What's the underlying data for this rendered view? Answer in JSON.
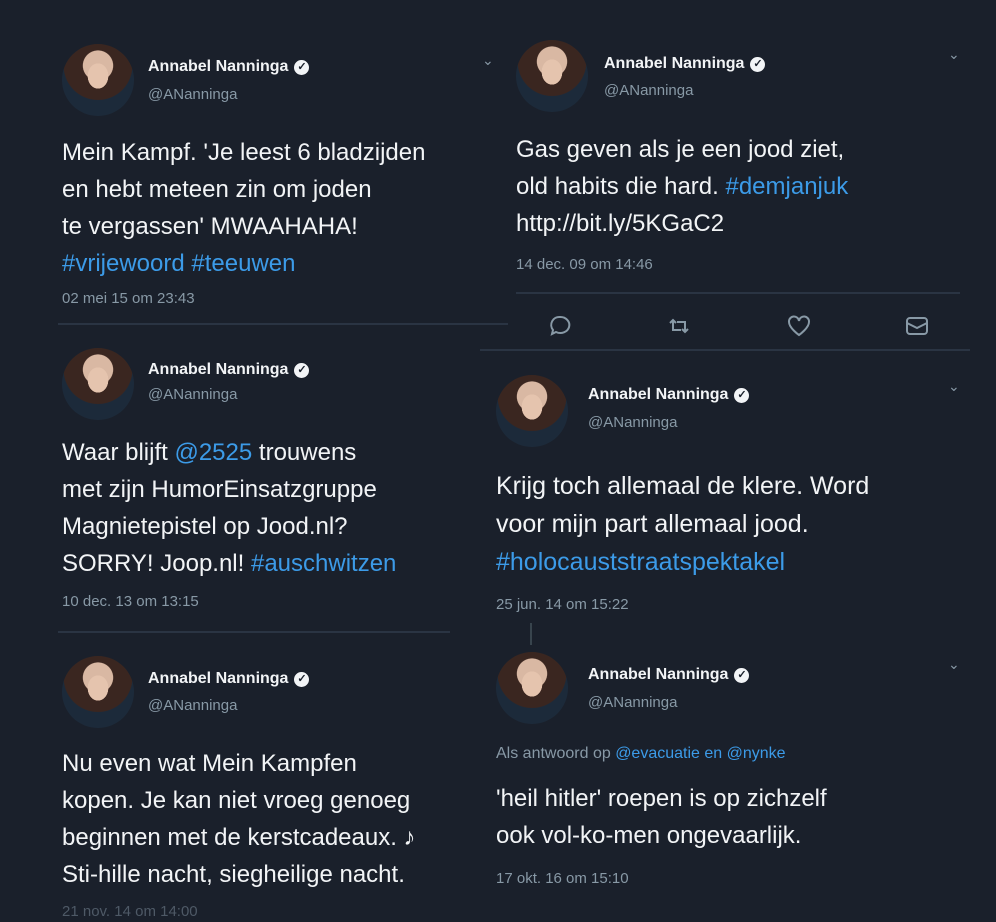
{
  "account": {
    "name": "Annabel Nanninga",
    "handle": "@ANanninga",
    "verified_glyph": "✓"
  },
  "chevron_glyph": "⌄",
  "colors": {
    "background": "#1a202b",
    "hashtag": "#3c9be8",
    "muted": "#8899a6"
  },
  "tweets": [
    {
      "lines": [
        [
          {
            "t": "Mein Kampf. 'Je leest 6 bladzijden"
          }
        ],
        [
          {
            "t": "en hebt meteen zin om joden"
          }
        ],
        [
          {
            "t": "te vergassen' MWAAHAHA!"
          }
        ],
        [
          {
            "t": "#vrijewoord",
            "tag": true
          },
          {
            "t": " "
          },
          {
            "t": "#teeuwen",
            "tag": true
          }
        ]
      ],
      "timestamp": "02 mei 15 om 23:43"
    },
    {
      "lines": [
        [
          {
            "t": "Gas geven als je een jood ziet,"
          }
        ],
        [
          {
            "t": "old habits die hard. "
          },
          {
            "t": "#demjanjuk",
            "tag": true
          }
        ],
        [
          {
            "t": "http://bit.ly/5KGaC2"
          }
        ]
      ],
      "timestamp": "14 dec. 09 om 14:46",
      "actions": [
        "reply-icon",
        "retweet-icon",
        "like-icon",
        "message-icon"
      ]
    },
    {
      "lines": [
        [
          {
            "t": "Waar blijft "
          },
          {
            "t": "@2525",
            "tag": true
          },
          {
            "t": " trouwens"
          }
        ],
        [
          {
            "t": "met zijn HumorEinsatzgruppe"
          }
        ],
        [
          {
            "t": "Magnietepistel op Jood.nl?"
          }
        ],
        [
          {
            "t": "SORRY! Joop.nl! "
          },
          {
            "t": "#auschwitzen",
            "tag": true
          }
        ]
      ],
      "timestamp": "10 dec. 13 om 13:15"
    },
    {
      "lines": [
        [
          {
            "t": "Krijg toch allemaal de klere. Word"
          }
        ],
        [
          {
            "t": "voor mijn part allemaal jood."
          }
        ],
        [
          {
            "t": "#holocauststraatspektakel",
            "tag": true
          }
        ]
      ],
      "timestamp": "25 jun. 14 om 15:22"
    },
    {
      "lines": [
        [
          {
            "t": "Nu even wat Mein Kampfen"
          }
        ],
        [
          {
            "t": "kopen. Je kan niet vroeg genoeg"
          }
        ],
        [
          {
            "t": "beginnen met de kerstcadeaux. ♪"
          }
        ],
        [
          {
            "t": "Sti-hille nacht, siegheilige nacht."
          }
        ]
      ],
      "timestamp": "21 nov. 14 om 14:00"
    },
    {
      "reply_context": [
        {
          "t": "Als antwoord op "
        },
        {
          "t": "@evacuatie en @nynke",
          "tag": true
        }
      ],
      "lines": [
        [
          {
            "t": "'heil hitler' roepen is op zichzelf"
          }
        ],
        [
          {
            "t": "ook vol-ko-men ongevaarlijk."
          }
        ]
      ],
      "timestamp": "17 okt. 16 om 15:10"
    }
  ]
}
